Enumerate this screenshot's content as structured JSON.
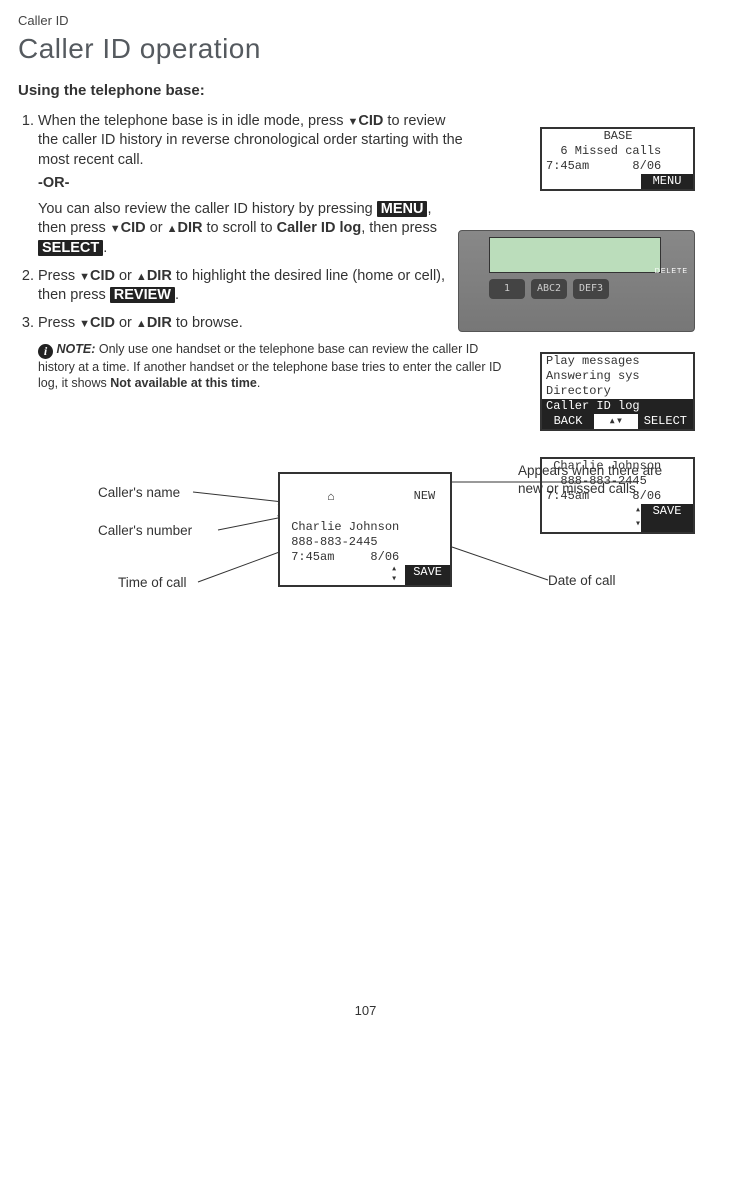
{
  "header": {
    "breadcrumb": "Caller ID",
    "title": "Caller ID operation",
    "subhead": "Using the telephone base:"
  },
  "steps": {
    "s1a": "When the telephone base is in idle mode, press ",
    "s1b": " to review the caller ID history in reverse chronological order starting with the most recent call.",
    "cid": "CID",
    "dir": "DIR",
    "or": "-OR-",
    "s1c_a": "You can also review the caller ID history by pressing ",
    "menu_pill": "MENU",
    "s1c_b": ", then press ",
    "s1c_c": " or ",
    "s1c_d": " to scroll to ",
    "cid_log": "Caller ID log",
    "s1c_e": ", then press ",
    "select_pill": "SELECT",
    "period": ".",
    "s2a": "Press ",
    "s2b": " or ",
    "s2c": " to highlight the desired line (home or cell), then press ",
    "review_pill": "REVIEW",
    "s3a": "Press ",
    "s3b": " or ",
    "s3c": " to browse."
  },
  "note": {
    "label": "NOTE:",
    "body_a": " Only use one handset or the telephone base can review the caller ID history at a time. If another handset or the telephone base tries to enter the caller ID log, it shows ",
    "not_avail": "Not available at this time",
    "body_b": "."
  },
  "lcd1": {
    "l1": "        BASE",
    "l2": "",
    "l3": "  6 Missed calls",
    "l4": "7:45am      8/06",
    "soft_right": "MENU"
  },
  "lcd2": {
    "l1": "Play messages",
    "l2": "Answering sys",
    "l3": "Directory",
    "l4": "Caller ID log",
    "soft_left": "BACK",
    "soft_right": "SELECT"
  },
  "lcd3": {
    "l1": " Charlie Johnson",
    "l2": "  888-883-2445",
    "l3": "",
    "l4": "7:45am      8/06",
    "soft_right": "SAVE"
  },
  "phone": {
    "k1": "1",
    "k2": "ABC2",
    "k3": "DEF3",
    "del": "DELETE"
  },
  "ann_lcd": {
    "l0": "           NEW",
    "l1": " Charlie Johnson",
    "l2": " 888-883-2445",
    "l3": "",
    "l4": " 7:45am     8/06",
    "soft_right": "SAVE"
  },
  "ann_labels": {
    "name": "Caller's name",
    "number": "Caller's number",
    "time": "Time of call",
    "date": "Date of call",
    "new": "Appears when there are new or missed calls."
  },
  "page": "107"
}
